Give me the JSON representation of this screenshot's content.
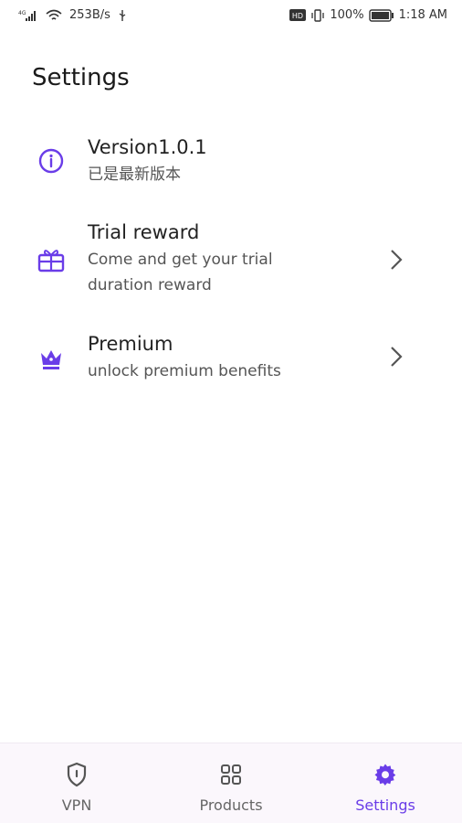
{
  "status_bar": {
    "network": "4G",
    "speed": "253B/s",
    "hd": "HD",
    "battery": "100%",
    "time": "1:18 AM"
  },
  "page": {
    "title": "Settings"
  },
  "settings": [
    {
      "icon": "info-icon",
      "title": "Version1.0.1",
      "subtitle": "已是最新版本",
      "has_chevron": false
    },
    {
      "icon": "gift-icon",
      "title": "Trial reward",
      "subtitle_line1": "Come and get your trial",
      "subtitle_line2": "duration reward",
      "has_chevron": true
    },
    {
      "icon": "crown-icon",
      "title": "Premium",
      "subtitle": "unlock premium benefits",
      "has_chevron": true
    }
  ],
  "bottom_nav": [
    {
      "label": "VPN",
      "icon": "shield-icon",
      "active": false
    },
    {
      "label": "Products",
      "icon": "grid-icon",
      "active": false
    },
    {
      "label": "Settings",
      "icon": "gear-icon",
      "active": true
    }
  ],
  "colors": {
    "accent": "#6a3de8",
    "nav_bg": "#fbf7fc",
    "text": "#222222"
  }
}
